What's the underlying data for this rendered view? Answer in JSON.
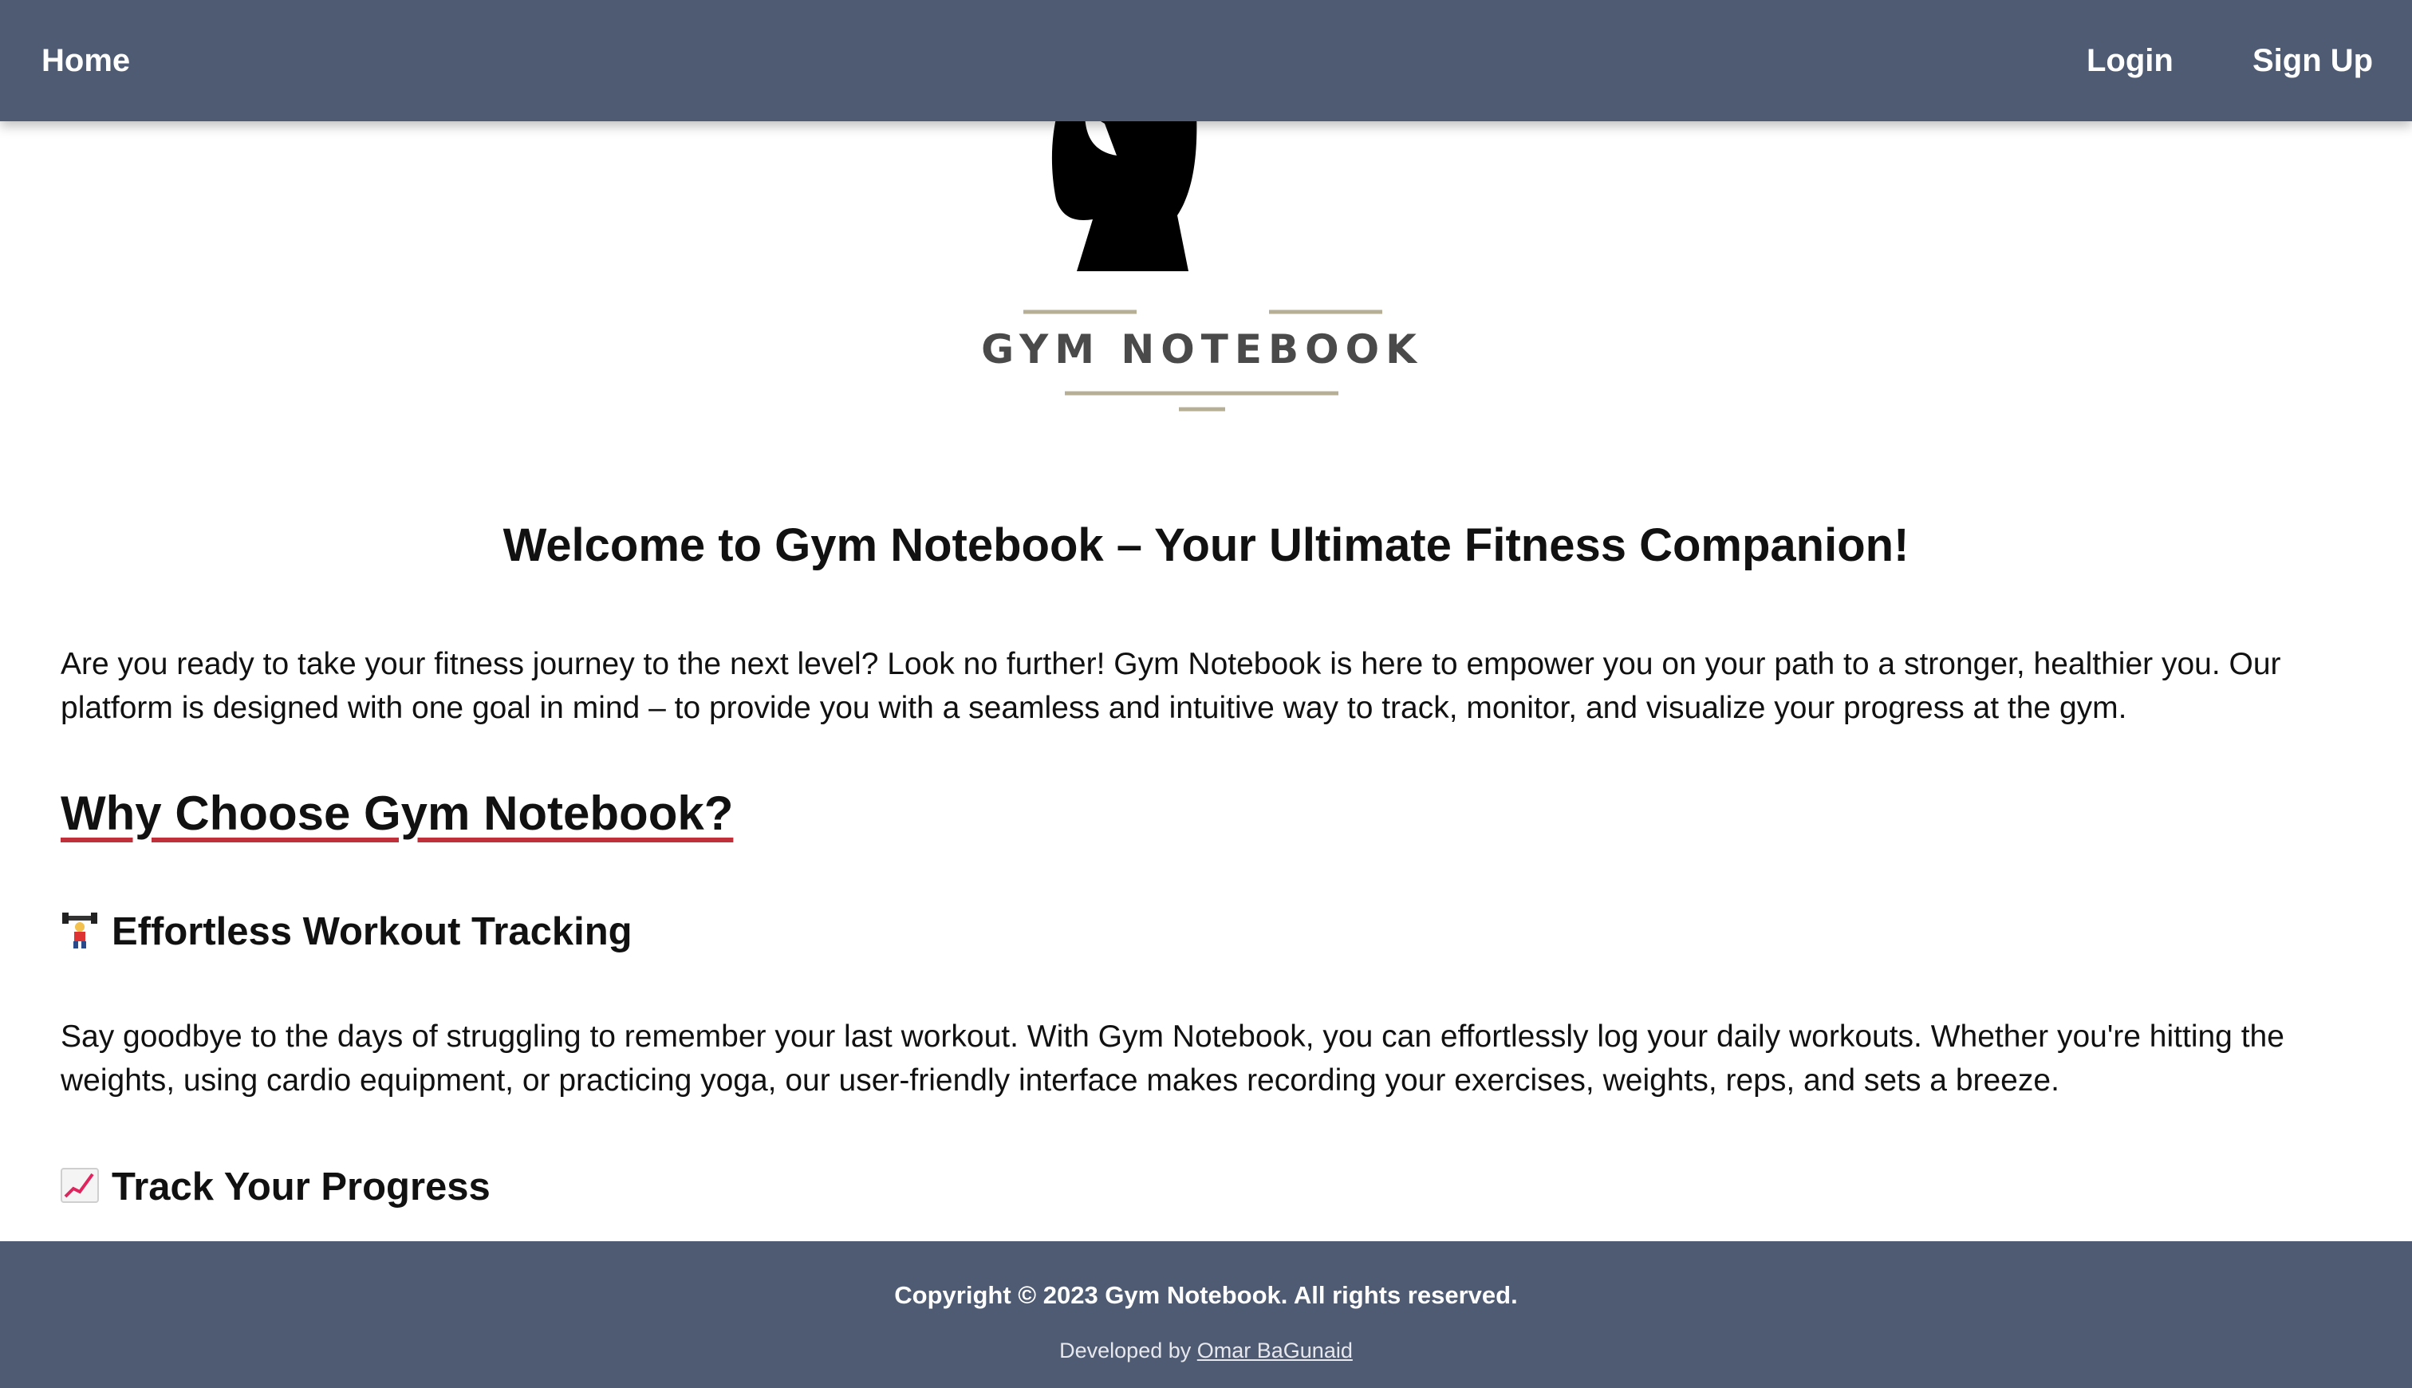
{
  "nav": {
    "home_label": "Home",
    "login_label": "Login",
    "signup_label": "Sign Up"
  },
  "logo": {
    "text": "GYM NOTEBOOK",
    "accent_color": "#b7ae96"
  },
  "main": {
    "welcome_title": "Welcome to Gym Notebook – Your Ultimate Fitness Companion!",
    "intro": "Are you ready to take your fitness journey to the next level? Look no further! Gym Notebook is here to empower you on your path to a stronger, healthier you. Our platform is designed with one goal in mind – to provide you with a seamless and intuitive way to track, monitor, and visualize your progress at the gym.",
    "why_title": "Why Choose Gym Notebook?",
    "features": [
      {
        "icon": "weightlifter-icon",
        "title": "Effortless Workout Tracking",
        "text": "Say goodbye to the days of struggling to remember your last workout. With Gym Notebook, you can effortlessly log your daily workouts. Whether you're hitting the weights, using cardio equipment, or practicing yoga, our user-friendly interface makes recording your exercises, weights, reps, and sets a breeze."
      },
      {
        "icon": "chart-increasing-icon",
        "title": "Track Your Progress"
      }
    ]
  },
  "footer": {
    "copyright": "Copyright © 2023 Gym Notebook. All rights reserved.",
    "developed_prefix": "Developed by ",
    "developer_name": "Omar BaGunaid"
  },
  "colors": {
    "nav_bg": "#4f5b73",
    "underline_accent": "#c0303a"
  }
}
